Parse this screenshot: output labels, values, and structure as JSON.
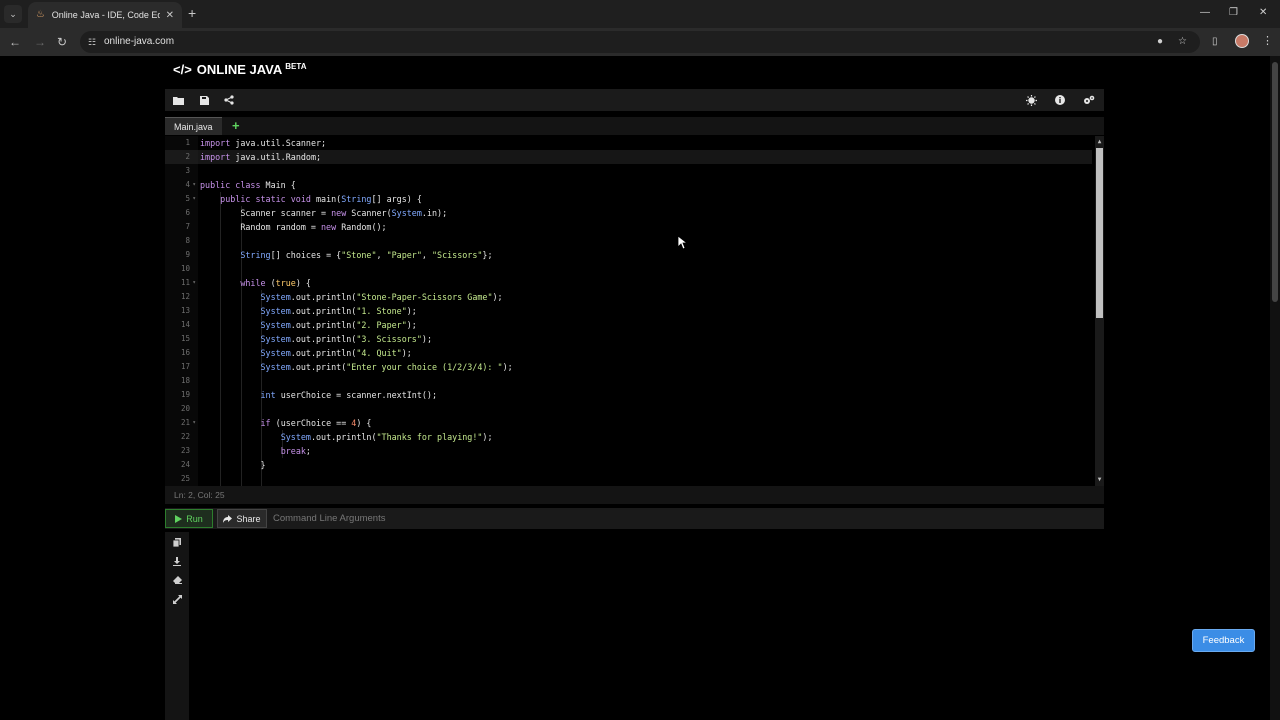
{
  "browser": {
    "tab_title": "Online Java - IDE, Code Editor",
    "url": "online-java.com"
  },
  "site": {
    "logo_code": "</>",
    "logo_text": "ONLINE JAVA",
    "logo_beta": "BETA"
  },
  "editor": {
    "file_tab": "Main.java",
    "status": "Ln: 2,  Col: 25",
    "lines": [
      "1",
      "2",
      "3",
      "4",
      "5",
      "6",
      "7",
      "8",
      "9",
      "10",
      "11",
      "12",
      "13",
      "14",
      "15",
      "16",
      "17",
      "18",
      "19",
      "20",
      "21",
      "22",
      "23",
      "24",
      "25"
    ]
  },
  "runbar": {
    "run_label": "Run",
    "share_label": "Share",
    "args_placeholder": "Command Line Arguments"
  },
  "feedback_label": "Feedback"
}
